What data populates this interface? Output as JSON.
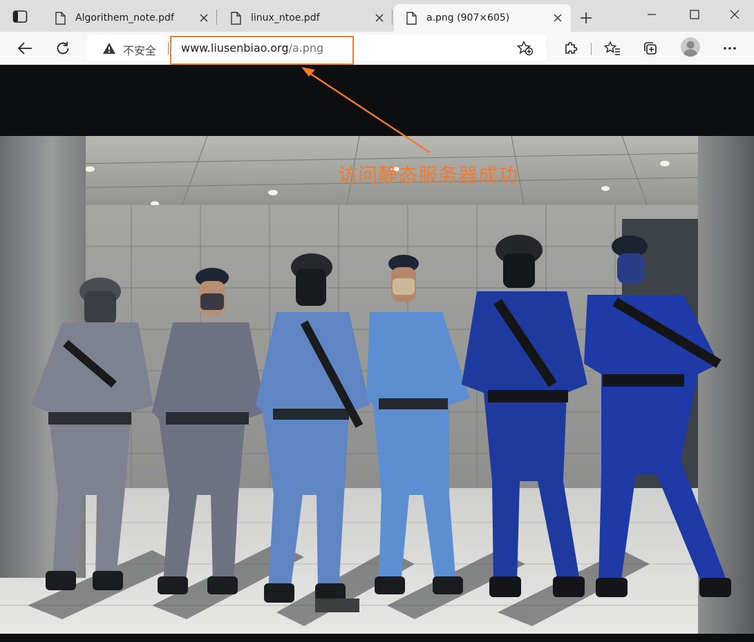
{
  "tabs": [
    {
      "title": "Algorithem_note.pdf",
      "active": false
    },
    {
      "title": "linux_ntoe.pdf",
      "active": false
    },
    {
      "title": "a.png (907×605)",
      "active": true
    }
  ],
  "address_bar": {
    "security_label": "不安全",
    "url_host": "www.liusenbiao.org",
    "url_path": "/a.png"
  },
  "annotation": {
    "text": "访问静态服务器成功",
    "color": "#f07b2c"
  },
  "icons": {
    "tab_actions": "sidebar-tabs-icon",
    "back": "back-arrow-icon",
    "reload": "reload-icon",
    "warning": "warning-triangle-icon",
    "add_favorite": "star-plus-icon",
    "extensions": "puzzle-icon",
    "favorites": "favorites-icon",
    "collections": "collections-icon",
    "profile": "profile-avatar-icon",
    "more": "ellipsis-icon"
  },
  "image": {
    "description": "Photo of six uniformed police officers in tactical gear standing in front of a building",
    "uniform_colors": [
      "#7d8190",
      "#6d7183",
      "#5f86c2",
      "#5d8ed1",
      "#1f3a9e",
      "#1e3aa6"
    ]
  }
}
